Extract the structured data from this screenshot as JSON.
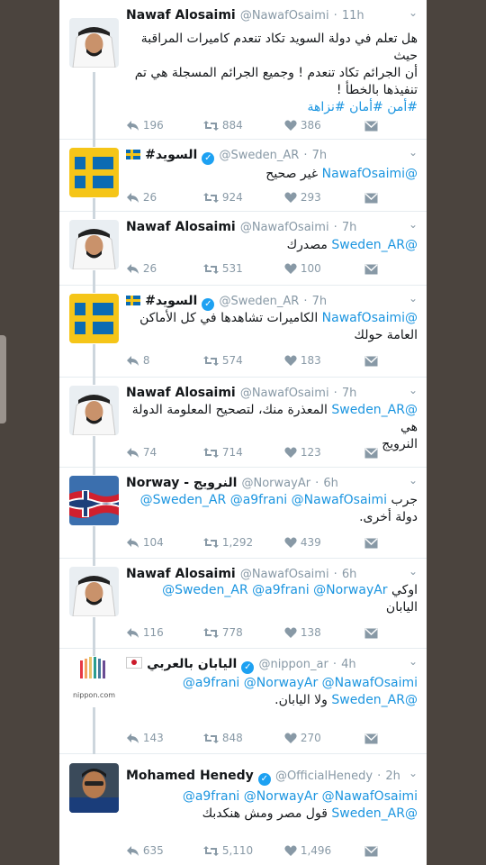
{
  "colors": {
    "accent": "#1b95e0",
    "meta": "#8899a6",
    "text": "#14171a",
    "verified": "#1da1f2"
  },
  "tweets": [
    {
      "name": "Nawaf Alosaimi",
      "handle": "@NawafOsaimi",
      "time": "11h",
      "avatar": "man-in-ghutra",
      "lines": [
        "هل تعلم في دولة السويد تكاد تنعدم كاميرات المراقبة حيث",
        "أن الجرائم تكاد تنعدم ! وجميع الجرائم المسجلة هي تم",
        "تنفيذها بالخطأ !"
      ],
      "hashtags": "#أمن #أمان #نزاهة",
      "replies": "196",
      "retweets": "884",
      "likes": "386"
    },
    {
      "name": "#السويد",
      "handle": "@Sweden_AR",
      "time": "7h",
      "avatar": "sweden-flag",
      "mentions": "@NawafOsaimi",
      "text": "غير صحيح",
      "replies": "26",
      "retweets": "924",
      "likes": "293"
    },
    {
      "name": "Nawaf Alosaimi",
      "handle": "@NawafOsaimi",
      "time": "7h",
      "avatar": "man-in-ghutra",
      "mentions": "@Sweden_AR",
      "text": "مصدرك",
      "replies": "26",
      "retweets": "531",
      "likes": "100"
    },
    {
      "name": "#السويد",
      "handle": "@Sweden_AR",
      "time": "7h",
      "avatar": "sweden-flag",
      "mentions": "@NawafOsaimi",
      "text": "الكاميرات تشاهدها في كل الأماكن",
      "text2": "العامة حولك",
      "replies": "8",
      "retweets": "574",
      "likes": "183"
    },
    {
      "name": "Nawaf Alosaimi",
      "handle": "@NawafOsaimi",
      "time": "7h",
      "avatar": "man-in-ghutra",
      "mentions": "@Sweden_AR",
      "text": "المعذرة منك، لتصحيح المعلومة الدولة هي",
      "text2": "النرويج",
      "replies": "74",
      "retweets": "714",
      "likes": "123"
    },
    {
      "name": "Norway - النرويج",
      "handle": "@NorwayAr",
      "time": "6h",
      "avatar": "norway-flag",
      "mentions": "@Sweden_AR @a9frani @NawafOsaimi",
      "text": "جرب",
      "text2": "دولة أخرى.",
      "replies": "104",
      "retweets": "1,292",
      "likes": "439"
    },
    {
      "name": "Nawaf Alosaimi",
      "handle": "@NawafOsaimi",
      "time": "6h",
      "avatar": "man-in-ghutra",
      "mentions": "@Sweden_AR @a9frani @NorwayAr",
      "text": "اوكي",
      "text2": "اليابان",
      "replies": "116",
      "retweets": "778",
      "likes": "138"
    },
    {
      "name": "اليابان بالعربي",
      "handle": "@nippon_ar",
      "time": "4h",
      "avatar": "nippon-logo",
      "avatar_text": "nippon.com",
      "mentions": "@a9frani @NorwayAr @NawafOsaimi",
      "mentions2": "@Sweden_AR",
      "text2": "ولا اليابان.",
      "replies": "143",
      "retweets": "848",
      "likes": "270"
    },
    {
      "name": "Mohamed Henedy",
      "handle": "@OfficialHenedy",
      "time": "2h",
      "avatar": "man-portrait",
      "mentions": "@a9frani @NorwayAr @NawafOsaimi",
      "mentions2": "@Sweden_AR",
      "text2": "قول مصر ومش هنكدبك",
      "replies": "635",
      "retweets": "5,110",
      "likes": "1,496"
    }
  ]
}
